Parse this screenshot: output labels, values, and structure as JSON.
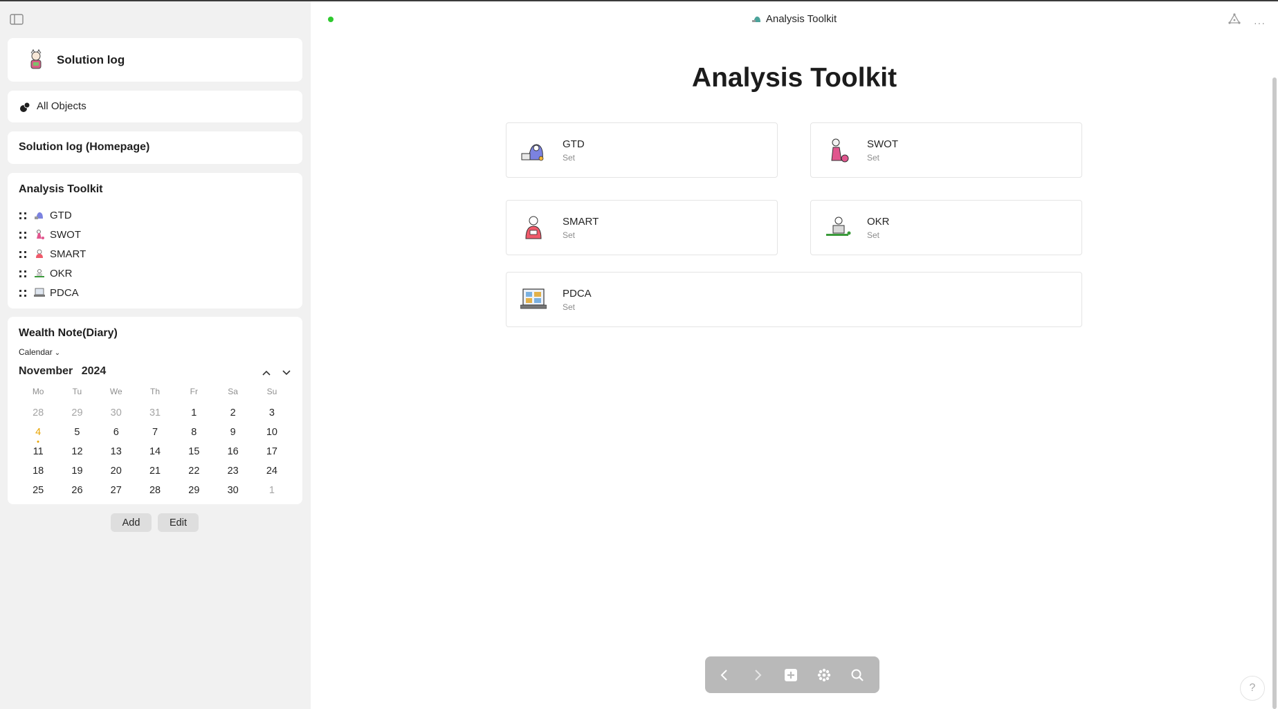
{
  "sidebar": {
    "space_name": "Solution log",
    "all_objects_label": "All Objects",
    "homepage_label": "Solution log (Homepage)",
    "toolkit": {
      "title": "Analysis Toolkit",
      "items": [
        {
          "label": "GTD",
          "icon": "gtd-mini-icon"
        },
        {
          "label": "SWOT",
          "icon": "swot-mini-icon"
        },
        {
          "label": "SMART",
          "icon": "smart-mini-icon"
        },
        {
          "label": "OKR",
          "icon": "okr-mini-icon"
        },
        {
          "label": "PDCA",
          "icon": "pdca-mini-icon"
        }
      ]
    },
    "wealth": {
      "title": "Wealth Note(Diary)",
      "view_label": "Calendar",
      "month": "November",
      "year": "2024",
      "weekdays": [
        "Mo",
        "Tu",
        "We",
        "Th",
        "Fr",
        "Sa",
        "Su"
      ],
      "weeks": [
        [
          "28",
          "29",
          "30",
          "31",
          "1",
          "2",
          "3"
        ],
        [
          "4",
          "5",
          "6",
          "7",
          "8",
          "9",
          "10"
        ],
        [
          "11",
          "12",
          "13",
          "14",
          "15",
          "16",
          "17"
        ],
        [
          "18",
          "19",
          "20",
          "21",
          "22",
          "23",
          "24"
        ],
        [
          "25",
          "26",
          "27",
          "28",
          "29",
          "30",
          "1"
        ]
      ],
      "today": "4"
    },
    "add_label": "Add",
    "edit_label": "Edit"
  },
  "header": {
    "title": "Analysis Toolkit",
    "more_label": "···"
  },
  "main": {
    "page_title": "Analysis Toolkit",
    "cards": [
      {
        "title": "GTD",
        "type": "Set"
      },
      {
        "title": "SWOT",
        "type": "Set"
      },
      {
        "title": "SMART",
        "type": "Set"
      },
      {
        "title": "OKR",
        "type": "Set"
      },
      {
        "title": "PDCA",
        "type": "Set"
      }
    ]
  },
  "help_label": "?",
  "colors": {
    "status_online": "#2ec92e",
    "today": "#e8a400",
    "sidebar_bg": "#f1f1f1",
    "navbar_bg": "#b9b9b9"
  }
}
